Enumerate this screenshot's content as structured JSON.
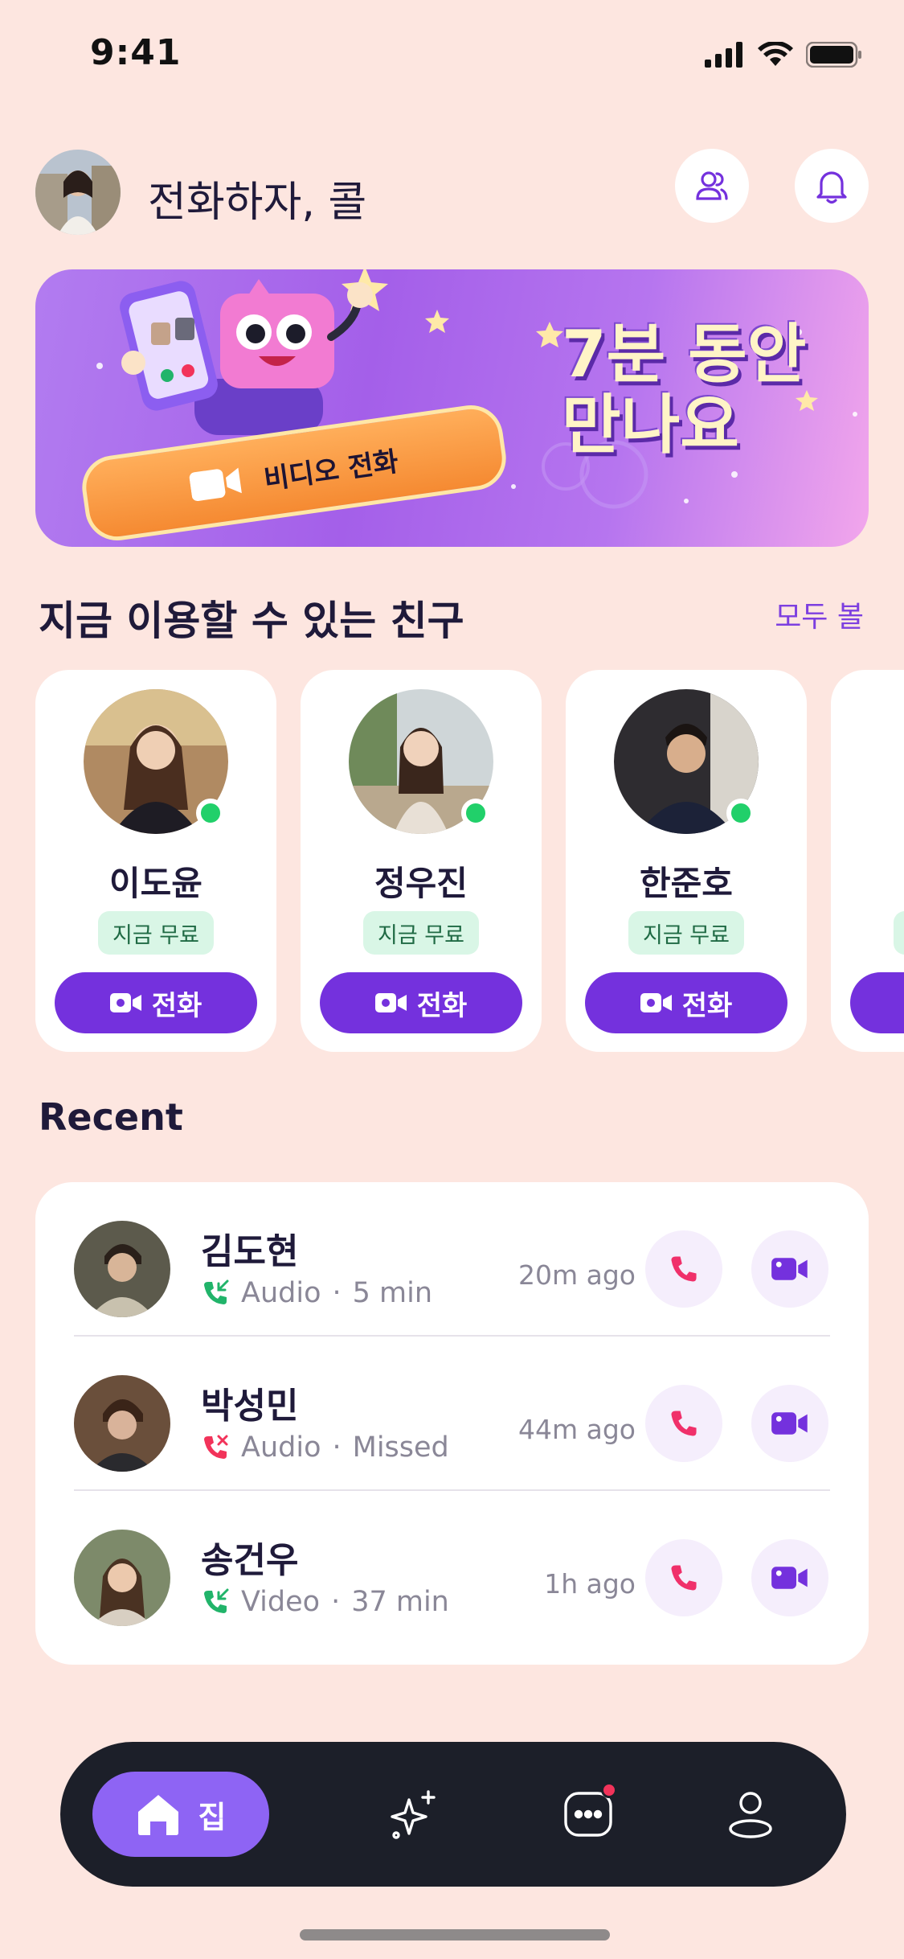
{
  "status_bar": {
    "time": "9:41"
  },
  "header": {
    "title": "전화하자, 콜"
  },
  "banner": {
    "headline_line1": "7분 동안",
    "headline_line2": "만나요",
    "cta_label": "비디오 전화"
  },
  "friends_section": {
    "title": "지금 이용할 수 있는 친구",
    "see_all": "모두 볼",
    "friends": [
      {
        "name": "이도윤",
        "badge": "지금 무료",
        "call_label": "전화",
        "photo_color": "#8b6a4e"
      },
      {
        "name": "정우진",
        "badge": "지금 무료",
        "call_label": "전화",
        "photo_color": "#c9b9a3"
      },
      {
        "name": "한준호",
        "badge": "지금 무료",
        "call_label": "전화",
        "photo_color": "#3b3a44"
      }
    ]
  },
  "recent": {
    "title": "Recent",
    "items": [
      {
        "name": "김도현",
        "type": "Audio",
        "detail": "5 min",
        "time": "20m ago",
        "status": "incoming",
        "photo_color": "#6b6a5a"
      },
      {
        "name": "박성민",
        "type": "Audio",
        "detail": "Missed",
        "time": "44m ago",
        "status": "missed",
        "photo_color": "#7a5a45"
      },
      {
        "name": "송건우",
        "type": "Video",
        "detail": "37 min",
        "time": "1h ago",
        "status": "incoming",
        "photo_color": "#8a7a66"
      }
    ]
  },
  "tabbar": {
    "home_label": "집",
    "active_tab": "home",
    "chat_has_notification": true
  },
  "colors": {
    "accent": "#7431dd",
    "online": "#21d06a",
    "missed": "#f2335a",
    "incoming": "#21b46a",
    "phone": "#f0306a"
  }
}
